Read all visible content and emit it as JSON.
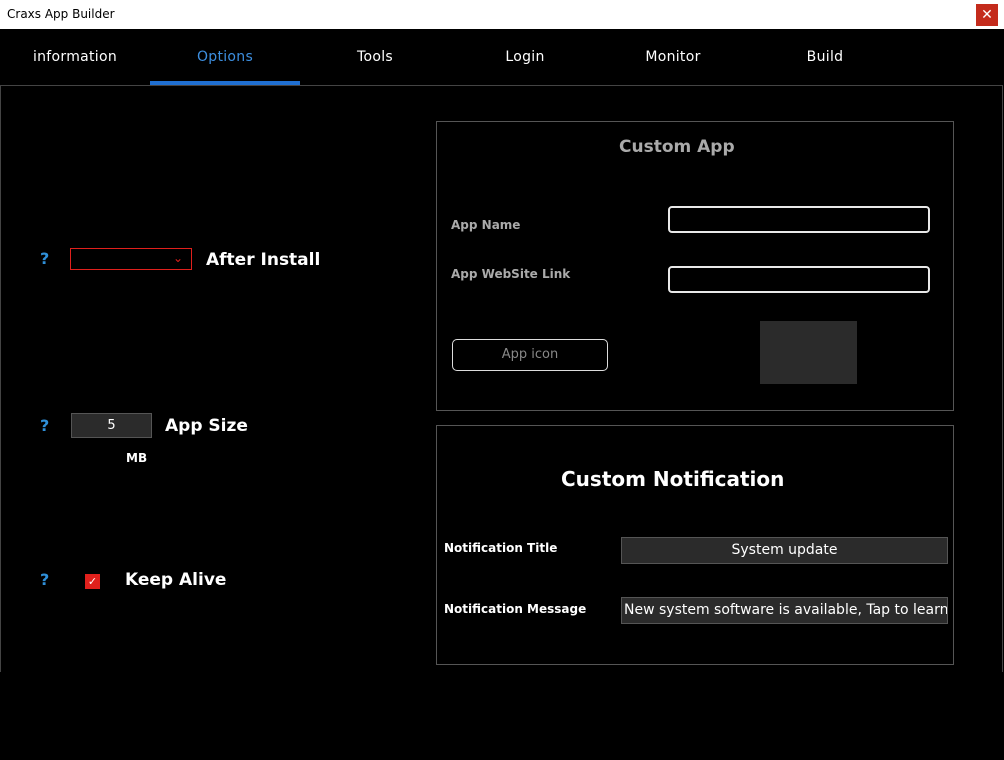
{
  "window": {
    "title": "Craxs App Builder",
    "close_glyph": "✕"
  },
  "tabs": [
    {
      "label": "information"
    },
    {
      "label": "Options"
    },
    {
      "label": "Tools"
    },
    {
      "label": "Login"
    },
    {
      "label": "Monitor"
    },
    {
      "label": "Build"
    }
  ],
  "active_tab": "Options",
  "colors": {
    "accent": "#1f6fd1",
    "help": "#2f8fd8",
    "danger": "#e0201c",
    "field_bg": "#2b2b2b"
  },
  "options": {
    "help_glyph": "?",
    "after_install": {
      "label": "After Install",
      "selected": "",
      "chevron": "⌄"
    },
    "app_size": {
      "label": "App Size",
      "value": "5",
      "unit": "MB"
    },
    "keep_alive": {
      "label": "Keep Alive",
      "checked": true,
      "check_glyph": "✓"
    }
  },
  "custom_app": {
    "title": "Custom App",
    "app_name_label": "App Name",
    "app_name_value": "",
    "website_label": "App WebSite Link",
    "website_value": "",
    "icon_button": "App icon"
  },
  "custom_notification": {
    "title": "Custom Notification",
    "title_label": "Notification Title",
    "title_value": "System update",
    "message_label": "Notification Message",
    "message_value": "New system software is available, Tap to learn more"
  }
}
